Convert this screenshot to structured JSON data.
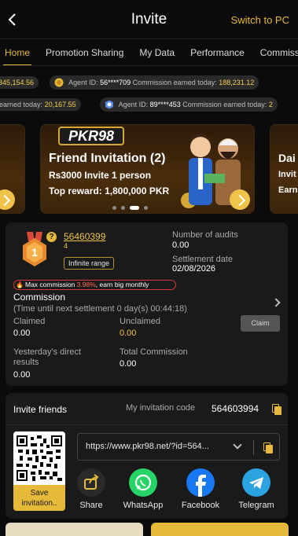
{
  "header": {
    "title": "Invite",
    "switch_label": "Switch to PC"
  },
  "tabs": [
    {
      "label": "Home",
      "active": true
    },
    {
      "label": "Promotion Sharing",
      "active": false
    },
    {
      "label": "My Data",
      "active": false
    },
    {
      "label": "Performance",
      "active": false
    },
    {
      "label": "Commiss",
      "active": false
    }
  ],
  "ticker1": {
    "amount_a": "345,154.56",
    "agent_label": "Agent ID:",
    "agent_id": "56****709",
    "earned_label": "Commission earned today:",
    "amount_b": "188,231.12"
  },
  "ticker2": {
    "earned_label_a": "earned today:",
    "amount_a": "20,167.55",
    "agent_label": "Agent ID:",
    "agent_id": "89****453",
    "earned_label_b": "Commission earned today:",
    "amount_b": "2"
  },
  "banner": {
    "logo": "PKR98",
    "heading": "Friend Invitation (2)",
    "line1": "Rs3000 Invite 1 person",
    "line2": "Top reward: 1,800,000 PKR",
    "right_heading": "Dai",
    "right_line1": "Invit",
    "right_line2": "Earn",
    "active_dot": 2
  },
  "agent": {
    "medal_level": "1",
    "id": "56460399",
    "id_sub": "4",
    "range": "Infinite range",
    "audits_label": "Number of audits",
    "audits_value": "0.00",
    "settle_label": "Settlement date",
    "settle_value": "02/08/2026",
    "promo_prefix": "Max commission ",
    "promo_rate": "3.98%",
    "promo_suffix": ", earn big monthly"
  },
  "commission": {
    "title": "Commission",
    "next_settle": "(Time until next settlement  0 day(s) 00:44:18)",
    "claimed_label": "Claimed",
    "claimed_value": "0.00",
    "unclaimed_label": "Unclaimed",
    "unclaimed_value": "0.00",
    "claim_button": "Claim",
    "yesterday_label_1": "Yesterday's direct",
    "yesterday_label_2": "results",
    "yesterday_value": "0.00",
    "total_label": "Total Commission",
    "total_value": "0.00"
  },
  "invite": {
    "title": "Invite friends",
    "code_label": "My invitation code",
    "code_value": "564603994",
    "link": "https://www.pkr98.net/?id=564...",
    "save_line1": "Save",
    "save_line2": "invitation..",
    "share": [
      {
        "label": "Share",
        "icon": "share-icon",
        "color": "#2a2a2a"
      },
      {
        "label": "WhatsApp",
        "icon": "whatsapp-icon",
        "color": "#25d366"
      },
      {
        "label": "Facebook",
        "icon": "facebook-icon",
        "color": "#1877f2"
      },
      {
        "label": "Telegram",
        "icon": "telegram-icon",
        "color": "#2aa3e0"
      }
    ]
  },
  "colors": {
    "accent": "#e6b93a",
    "background": "#0b0b0b",
    "card": "#1a1a1a"
  }
}
